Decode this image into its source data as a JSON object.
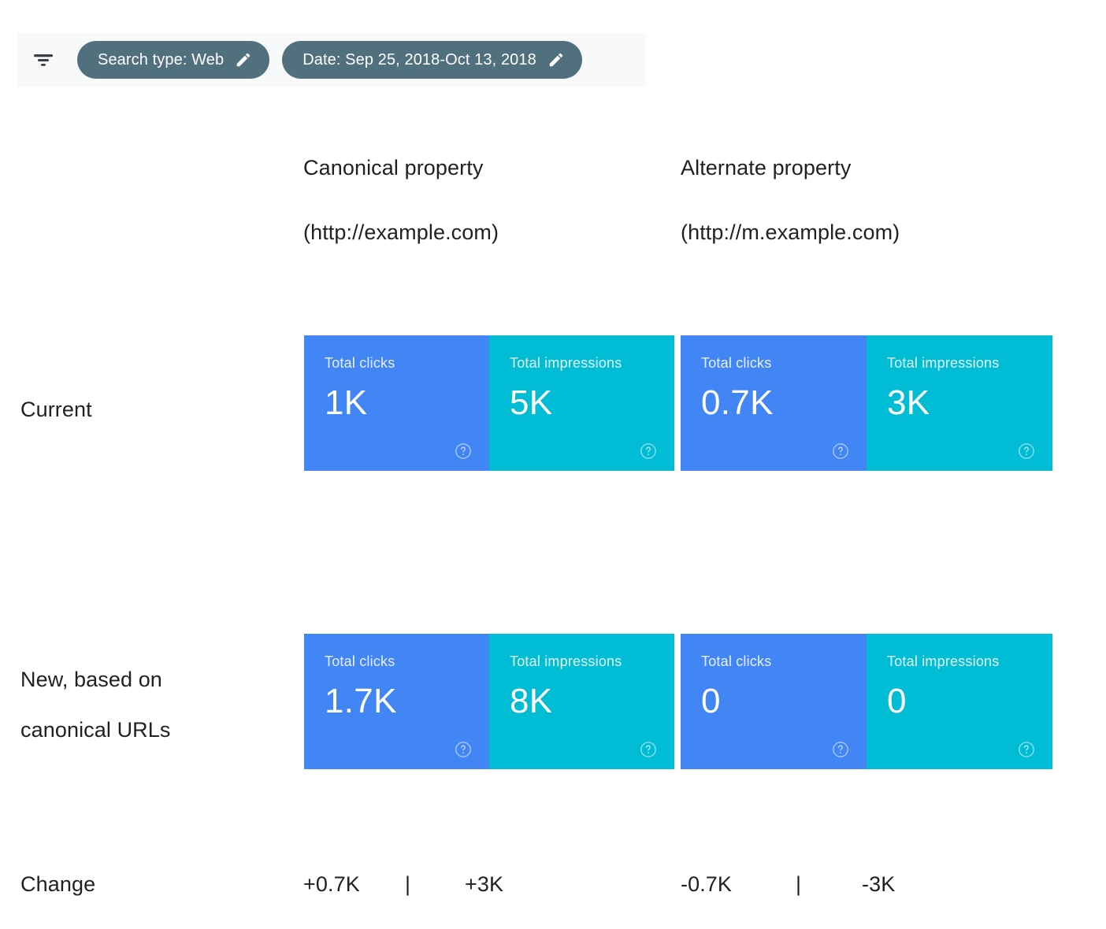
{
  "toolbar": {
    "filter_icon": "filter-list-icon",
    "chips": [
      {
        "label": "Search type: Web",
        "edit_icon": "pencil-icon"
      },
      {
        "label": "Date: Sep 25, 2018-Oct 13, 2018",
        "edit_icon": "pencil-icon"
      }
    ]
  },
  "columns": [
    {
      "title": "Canonical property",
      "url": "(http://example.com)"
    },
    {
      "title": "Alternate property",
      "url": "(http://m.example.com)"
    }
  ],
  "rows": {
    "current_label": "Current",
    "new_label_line1": "New, based on",
    "new_label_line2": "canonical URLs",
    "change_label": "Change"
  },
  "cards": {
    "canonical_current": [
      {
        "title": "Total clicks",
        "value": "1K",
        "help_icon": "help-circle-icon",
        "color": "#4285f4"
      },
      {
        "title": "Total impressions",
        "value": "5K",
        "help_icon": "help-circle-icon",
        "color": "#00bcd4"
      }
    ],
    "alternate_current": [
      {
        "title": "Total clicks",
        "value": "0.7K",
        "help_icon": "help-circle-icon",
        "color": "#4285f4"
      },
      {
        "title": "Total impressions",
        "value": "3K",
        "help_icon": "help-circle-icon",
        "color": "#00bcd4"
      }
    ],
    "canonical_new": [
      {
        "title": "Total clicks",
        "value": "1.7K",
        "help_icon": "help-circle-icon",
        "color": "#4285f4"
      },
      {
        "title": "Total impressions",
        "value": "8K",
        "help_icon": "help-circle-icon",
        "color": "#00bcd4"
      }
    ],
    "alternate_new": [
      {
        "title": "Total clicks",
        "value": "0",
        "help_icon": "help-circle-icon",
        "color": "#4285f4"
      },
      {
        "title": "Total impressions",
        "value": "0",
        "help_icon": "help-circle-icon",
        "color": "#00bcd4"
      }
    ]
  },
  "change": {
    "canonical_clicks": "+0.7K",
    "canonical_separator": "|",
    "canonical_impressions": "+3K",
    "alternate_clicks": "-0.7K",
    "alternate_separator": "|",
    "alternate_impressions": "-3K"
  },
  "chart_data": {
    "type": "table",
    "title": "Canonical vs Alternate property metrics",
    "column_headers": [
      "Canonical property (http://example.com)",
      "Alternate property (http://m.example.com)"
    ],
    "row_headers": [
      "Current",
      "New, based on canonical URLs",
      "Change"
    ],
    "metrics": [
      "Total clicks",
      "Total impressions"
    ],
    "values": {
      "current": {
        "canonical": {
          "clicks": 1000,
          "impressions": 5000
        },
        "alternate": {
          "clicks": 700,
          "impressions": 3000
        }
      },
      "new": {
        "canonical": {
          "clicks": 1700,
          "impressions": 8000
        },
        "alternate": {
          "clicks": 0,
          "impressions": 0
        }
      },
      "change": {
        "canonical": {
          "clicks": 700,
          "impressions": 3000
        },
        "alternate": {
          "clicks": -700,
          "impressions": -3000
        }
      }
    },
    "display_values": {
      "current": {
        "canonical": [
          "1K",
          "5K"
        ],
        "alternate": [
          "0.7K",
          "3K"
        ]
      },
      "new": {
        "canonical": [
          "1.7K",
          "8K"
        ],
        "alternate": [
          "0",
          "0"
        ]
      },
      "change": {
        "canonical": [
          "+0.7K",
          "+3K"
        ],
        "alternate": [
          "-0.7K",
          "-3K"
        ]
      }
    },
    "colors": {
      "clicks": "#4285f4",
      "impressions": "#00bcd4",
      "chip": "#51707e"
    }
  }
}
